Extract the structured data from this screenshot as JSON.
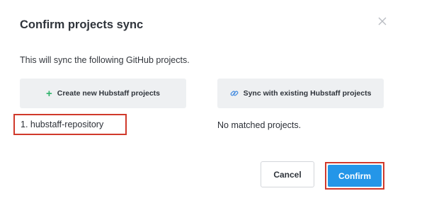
{
  "dialog": {
    "title": "Confirm projects sync",
    "close_icon": "close-icon",
    "description": "This will sync the following GitHub projects."
  },
  "options": {
    "create": {
      "icon": "plus-icon",
      "label": "Create new Hubstaff projects"
    },
    "sync": {
      "icon": "link-icon",
      "label": "Sync with existing Hubstaff projects"
    }
  },
  "projects": [
    "1. hubstaff-repository"
  ],
  "matched_status": "No matched projects.",
  "buttons": {
    "cancel": "Cancel",
    "confirm": "Confirm"
  },
  "colors": {
    "accent": "#2496e8",
    "highlight": "#d0392b",
    "plus": "#2fb36b",
    "link": "#4a8fe0"
  }
}
